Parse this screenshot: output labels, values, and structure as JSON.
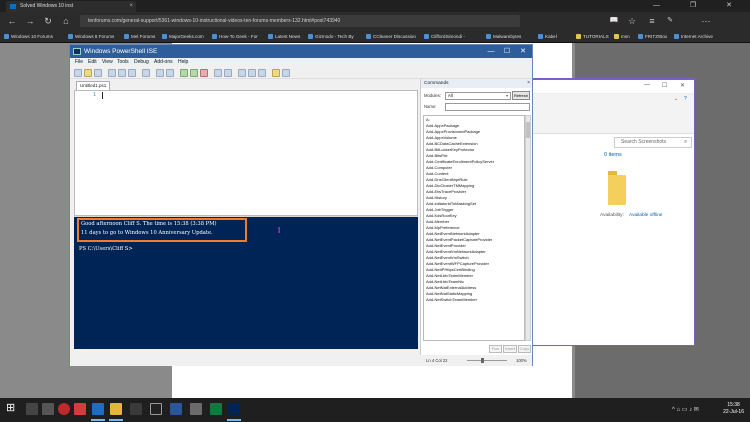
{
  "browser": {
    "tab_title": "Solved Windows 10 inst",
    "tab_close": "×",
    "url": "tenforums.com/general-support/5361-windows-10-instructional-videos-ten-forums-members-132.html#post743940",
    "window_controls": "—  ❐  ✕",
    "nav": {
      "back": "←",
      "forward": "→",
      "refresh": "↻",
      "home": "⌂"
    },
    "toolbar_icons": {
      "reading": "📖",
      "favorite": "☆",
      "hub": "≡",
      "share": "✎",
      "more": "⋯"
    },
    "bookmarks": [
      "Windows 10 Forums",
      "Windows 8 Forums",
      "Mel Forums",
      "MajorGeeks.com",
      "How-To Geek - For",
      "Latest News",
      "Gizmodo - Tech By",
      "CCleaner Discussion",
      "CliffordSimondi -",
      "Malwarebytes",
      "Kabel",
      "TUTORIALS",
      "msn",
      "FRITZ!Box",
      "Internet Archive"
    ]
  },
  "explorer": {
    "search_placeholder": "Search Screenshots",
    "items_count": "0 items",
    "availability_label": "Availability:",
    "availability_value": "Available offline",
    "controls": {
      "minimize": "—",
      "maximize": "☐",
      "close": "✕",
      "expand": "⌄",
      "help": "?"
    }
  },
  "ise": {
    "title": "Windows PowerShell ISE",
    "window_controls": {
      "minimize": "—",
      "maximize": "☐",
      "close": "✕"
    },
    "menu": [
      "File",
      "Edit",
      "View",
      "Tools",
      "Debug",
      "Add-ons",
      "Help"
    ],
    "script_tab": "Untitled1.ps1",
    "line_number": "1",
    "console_lines": [
      "Good afternoon Cliff S. The time is 15:38 (3:38 PM)",
      "11 days to go to Windows 10 Anniversary Update."
    ],
    "prompt": "PS C:\\Users\\Cliff S>",
    "status": {
      "position": "Ln 4  Col 22",
      "zoom": "100%"
    }
  },
  "commands": {
    "title": "Commands",
    "close": "×",
    "modules_label": "Modules:",
    "modules_value": "All",
    "refresh_label": "Refresh",
    "name_label": "Name:",
    "items": [
      "A:",
      "Add-AppxPackage",
      "Add-AppxProvisionedPackage",
      "Add-AppxVolume",
      "Add-BCDataCacheExtension",
      "Add-BitLockerKeyProtector",
      "Add-BitsFile",
      "Add-CertificateEnrollmentPolicyServer",
      "Add-Computer",
      "Add-Content",
      "Add-DnsClientNrptRule",
      "Add-DtcClusterTMMapping",
      "Add-EtwTraceProvider",
      "Add-History",
      "Add-InitiatorIdToMaskingSet",
      "Add-JobTrigger",
      "Add-KdsRootKey",
      "Add-Member",
      "Add-MpPreference",
      "Add-NetEventNetworkAdapter",
      "Add-NetEventPacketCaptureProvider",
      "Add-NetEventProvider",
      "Add-NetEventVmNetworkAdapter",
      "Add-NetEventVmSwitch",
      "Add-NetEventWFPCaptureProvider",
      "Add-NetIPHttpsCertBinding",
      "Add-NetLbfoTeamMember",
      "Add-NetLbfoTeamNic",
      "Add-NetNatExternalAddress",
      "Add-NetNatStaticMapping",
      "Add-NetSwitchTeamMember"
    ],
    "buttons": {
      "run": "Run",
      "insert": "Insert",
      "copy": "Copy"
    }
  },
  "taskbar": {
    "start": "⊞",
    "time": "15:38",
    "date": "22-Jul-16",
    "tray": "^  ⌂  ▭  ♪  ✉"
  }
}
